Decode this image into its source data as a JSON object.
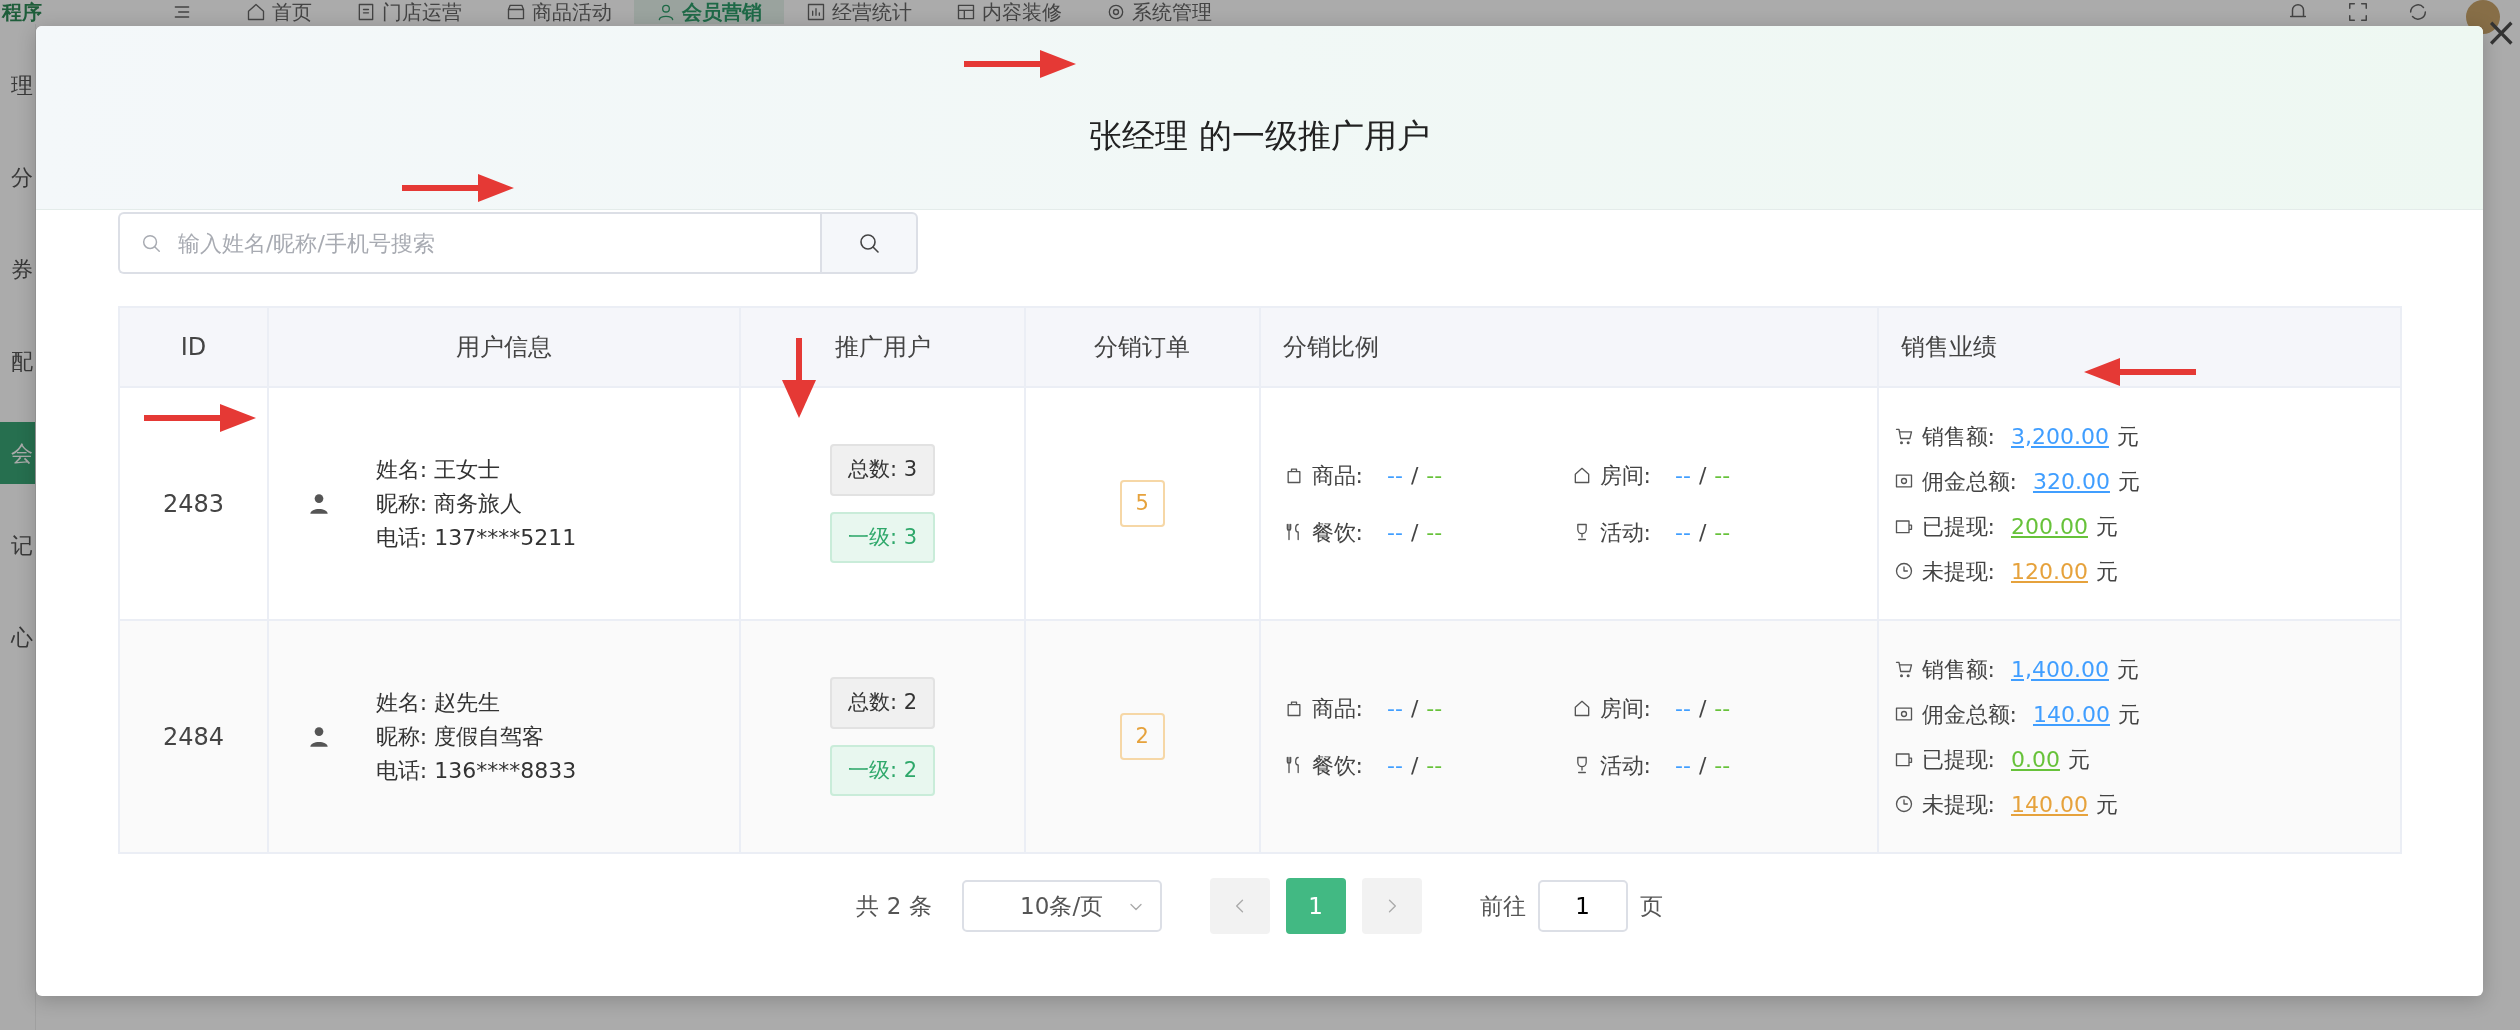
{
  "top_nav": {
    "app_title": "程序",
    "items": [
      {
        "label": "首页",
        "selected": false
      },
      {
        "label": "门店运营",
        "selected": false
      },
      {
        "label": "商品活动",
        "selected": false
      },
      {
        "label": "会员营销",
        "selected": true
      },
      {
        "label": "经营统计",
        "selected": false
      },
      {
        "label": "内容装修",
        "selected": false
      },
      {
        "label": "系统管理",
        "selected": false
      }
    ]
  },
  "sidebar": {
    "items": [
      {
        "label": "理",
        "selected": false
      },
      {
        "label": "分",
        "selected": false
      },
      {
        "label": "券",
        "selected": false
      },
      {
        "label": "配",
        "selected": false
      },
      {
        "label": "会",
        "selected": true
      },
      {
        "label": "记",
        "selected": false
      },
      {
        "label": "心",
        "selected": false
      }
    ]
  },
  "dialog": {
    "title": "张经理 的一级推广用户",
    "close": "×",
    "search": {
      "placeholder": "输入姓名/昵称/手机号搜索"
    },
    "table": {
      "columns": [
        "ID",
        "用户信息",
        "推广用户",
        "分销订单",
        "分销比例",
        "销售业绩"
      ],
      "rows": [
        {
          "id": "2483",
          "user": [
            "姓名: 王女士",
            "昵称: 商务旅人",
            "电话: 137****5211"
          ],
          "promo": {
            "total": "总数: 3",
            "level1": "一级: 3"
          },
          "orders": "5",
          "ratios": [
            {
              "kind": "goods",
              "label": "商品:",
              "a": "--",
              "sep": "/",
              "b": "--"
            },
            {
              "kind": "room",
              "label": "房间:",
              "a": "--",
              "sep": "/",
              "b": "--"
            },
            {
              "kind": "dining",
              "label": "餐饮:",
              "a": "--",
              "sep": "/",
              "b": "--"
            },
            {
              "kind": "activity",
              "label": "活动:",
              "a": "--",
              "sep": "/",
              "b": "--"
            }
          ],
          "sales": [
            {
              "kind": "sales",
              "label": "销售额:",
              "value": "3,200.00",
              "unit": "元"
            },
            {
              "kind": "commission",
              "label": "佣金总额:",
              "value": "320.00",
              "unit": "元"
            },
            {
              "kind": "withdrawn",
              "label": "已提现:",
              "value": "200.00",
              "unit": "元"
            },
            {
              "kind": "pending",
              "label": "未提现:",
              "value": "120.00",
              "unit": "元"
            }
          ]
        },
        {
          "id": "2484",
          "user": [
            "姓名: 赵先生",
            "昵称: 度假自驾客",
            "电话: 136****8833"
          ],
          "promo": {
            "total": "总数: 2",
            "level1": "一级: 2"
          },
          "orders": "2",
          "ratios": [
            {
              "kind": "goods",
              "label": "商品:",
              "a": "--",
              "sep": "/",
              "b": "--"
            },
            {
              "kind": "room",
              "label": "房间:",
              "a": "--",
              "sep": "/",
              "b": "--"
            },
            {
              "kind": "dining",
              "label": "餐饮:",
              "a": "--",
              "sep": "/",
              "b": "--"
            },
            {
              "kind": "activity",
              "label": "活动:",
              "a": "--",
              "sep": "/",
              "b": "--"
            }
          ],
          "sales": [
            {
              "kind": "sales",
              "label": "销售额:",
              "value": "1,400.00",
              "unit": "元"
            },
            {
              "kind": "commission",
              "label": "佣金总额:",
              "value": "140.00",
              "unit": "元"
            },
            {
              "kind": "withdrawn",
              "label": "已提现:",
              "value": "0.00",
              "unit": "元"
            },
            {
              "kind": "pending",
              "label": "未提现:",
              "value": "140.00",
              "unit": "元"
            }
          ]
        }
      ]
    },
    "pagination": {
      "total": "共 2 条",
      "page_size": "10条/页",
      "pages": [
        {
          "label": "1",
          "selected": true
        }
      ],
      "goto_label": "前往",
      "goto_value": "1",
      "goto_unit": "页"
    }
  },
  "annotation_arrows": [
    {
      "kind": "right"
    },
    {
      "kind": "right"
    },
    {
      "kind": "right"
    },
    {
      "kind": "down"
    },
    {
      "kind": "left"
    }
  ]
}
